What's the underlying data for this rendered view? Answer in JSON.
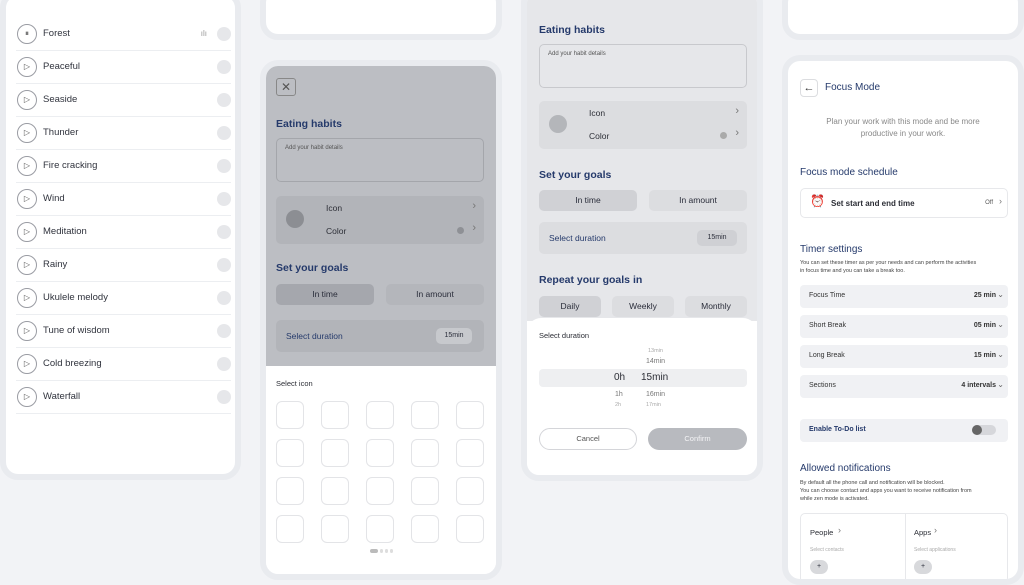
{
  "sounds": {
    "items": [
      "Forest",
      "Peaceful",
      "Seaside",
      "Thunder",
      "Fire cracking",
      "Wind",
      "Meditation",
      "Rainy",
      "Ukulele melody",
      "Tune of wisdom",
      "Cold breezing",
      "Waterfall"
    ]
  },
  "habit": {
    "title": "Eating habits",
    "placeholder": "Add your habit details",
    "icon_label": "Icon",
    "color_label": "Color",
    "goals_title": "Set your goals",
    "in_time": "In time",
    "in_amount": "In amount",
    "select_duration": "Select duration",
    "duration_value": "15min",
    "select_icon": "Select icon"
  },
  "habit2": {
    "repeat_title": "Repeat your goals in",
    "daily": "Daily",
    "weekly": "Weekly",
    "monthly": "Monthly",
    "sheet_title": "Select duration",
    "picker": {
      "above2": "13min",
      "above1": "14min",
      "hours": "0h",
      "minutes": "15min",
      "below_h1": "1h",
      "below_m1": "16min",
      "below_h2": "2h",
      "below_m2": "17min"
    },
    "cancel": "Cancel",
    "confirm": "Confirm"
  },
  "focus": {
    "title": "Focus Mode",
    "subtitle_1": "Plan your work with this mode and be more",
    "subtitle_2": "productive in your work.",
    "schedule_title": "Focus mode schedule",
    "schedule_label": "Set start and end time",
    "schedule_state": "Off",
    "timer_title": "Timer settings",
    "timer_desc_1": "You can set these timer as per your needs and can perform the activities",
    "timer_desc_2": "in focus time and you can take a break too.",
    "rows": [
      {
        "label": "Focus Time",
        "value": "25 min"
      },
      {
        "label": "Short Break",
        "value": "05 min"
      },
      {
        "label": "Long Break",
        "value": "15 min"
      },
      {
        "label": "Sections",
        "value": "4 intervals"
      }
    ],
    "todo": "Enable To-Do list",
    "notif_title": "Allowed notifications",
    "notif_desc_1": "By default all the phone call  and notification will be blocked.",
    "notif_desc_2": "You can choose contact and apps you want to receive notification from",
    "notif_desc_3": "while zen mode is activated.",
    "people": "People",
    "people_sub": "Select contacts",
    "apps": "Apps",
    "apps_sub": "Select applications"
  }
}
